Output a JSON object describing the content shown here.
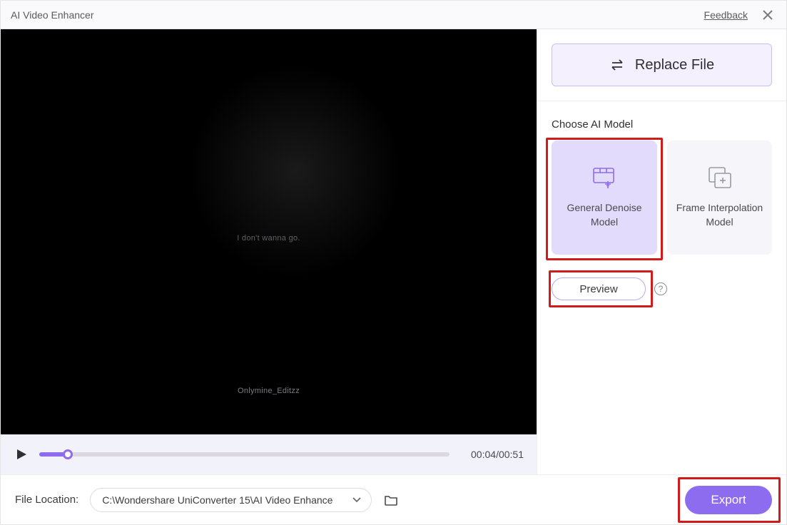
{
  "titlebar": {
    "title": "AI Video Enhancer",
    "feedback": "Feedback"
  },
  "playback": {
    "current": "00:04",
    "duration": "00:51"
  },
  "watermark": {
    "line1": "I don't wanna go.",
    "line2": "Onlymine_Editzz"
  },
  "panel": {
    "replace_label": "Replace File",
    "section_title": "Choose AI Model",
    "model_general": "General Denoise Model",
    "model_interp": "Frame Interpolation Model",
    "preview_label": "Preview"
  },
  "footer": {
    "file_label": "File Location:",
    "path": "C:\\Wondershare UniConverter 15\\AI Video Enhance",
    "export_label": "Export"
  }
}
